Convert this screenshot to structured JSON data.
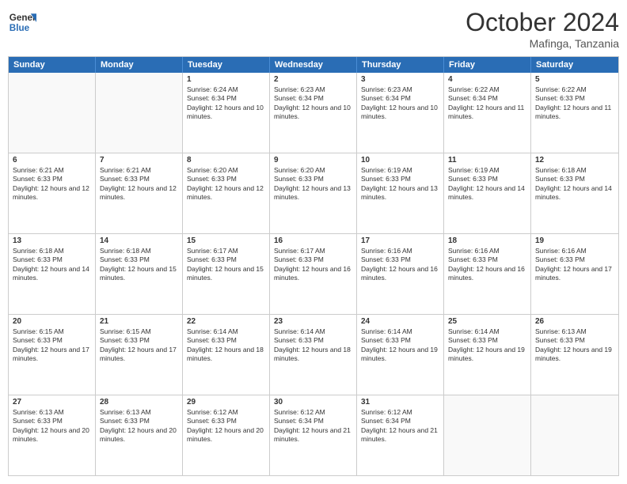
{
  "header": {
    "logo_line1": "General",
    "logo_line2": "Blue",
    "month": "October 2024",
    "location": "Mafinga, Tanzania"
  },
  "days_of_week": [
    "Sunday",
    "Monday",
    "Tuesday",
    "Wednesday",
    "Thursday",
    "Friday",
    "Saturday"
  ],
  "weeks": [
    [
      {
        "day": "",
        "sunrise": "",
        "sunset": "",
        "daylight": ""
      },
      {
        "day": "",
        "sunrise": "",
        "sunset": "",
        "daylight": ""
      },
      {
        "day": "1",
        "sunrise": "Sunrise: 6:24 AM",
        "sunset": "Sunset: 6:34 PM",
        "daylight": "Daylight: 12 hours and 10 minutes."
      },
      {
        "day": "2",
        "sunrise": "Sunrise: 6:23 AM",
        "sunset": "Sunset: 6:34 PM",
        "daylight": "Daylight: 12 hours and 10 minutes."
      },
      {
        "day": "3",
        "sunrise": "Sunrise: 6:23 AM",
        "sunset": "Sunset: 6:34 PM",
        "daylight": "Daylight: 12 hours and 10 minutes."
      },
      {
        "day": "4",
        "sunrise": "Sunrise: 6:22 AM",
        "sunset": "Sunset: 6:34 PM",
        "daylight": "Daylight: 12 hours and 11 minutes."
      },
      {
        "day": "5",
        "sunrise": "Sunrise: 6:22 AM",
        "sunset": "Sunset: 6:33 PM",
        "daylight": "Daylight: 12 hours and 11 minutes."
      }
    ],
    [
      {
        "day": "6",
        "sunrise": "Sunrise: 6:21 AM",
        "sunset": "Sunset: 6:33 PM",
        "daylight": "Daylight: 12 hours and 12 minutes."
      },
      {
        "day": "7",
        "sunrise": "Sunrise: 6:21 AM",
        "sunset": "Sunset: 6:33 PM",
        "daylight": "Daylight: 12 hours and 12 minutes."
      },
      {
        "day": "8",
        "sunrise": "Sunrise: 6:20 AM",
        "sunset": "Sunset: 6:33 PM",
        "daylight": "Daylight: 12 hours and 12 minutes."
      },
      {
        "day": "9",
        "sunrise": "Sunrise: 6:20 AM",
        "sunset": "Sunset: 6:33 PM",
        "daylight": "Daylight: 12 hours and 13 minutes."
      },
      {
        "day": "10",
        "sunrise": "Sunrise: 6:19 AM",
        "sunset": "Sunset: 6:33 PM",
        "daylight": "Daylight: 12 hours and 13 minutes."
      },
      {
        "day": "11",
        "sunrise": "Sunrise: 6:19 AM",
        "sunset": "Sunset: 6:33 PM",
        "daylight": "Daylight: 12 hours and 14 minutes."
      },
      {
        "day": "12",
        "sunrise": "Sunrise: 6:18 AM",
        "sunset": "Sunset: 6:33 PM",
        "daylight": "Daylight: 12 hours and 14 minutes."
      }
    ],
    [
      {
        "day": "13",
        "sunrise": "Sunrise: 6:18 AM",
        "sunset": "Sunset: 6:33 PM",
        "daylight": "Daylight: 12 hours and 14 minutes."
      },
      {
        "day": "14",
        "sunrise": "Sunrise: 6:18 AM",
        "sunset": "Sunset: 6:33 PM",
        "daylight": "Daylight: 12 hours and 15 minutes."
      },
      {
        "day": "15",
        "sunrise": "Sunrise: 6:17 AM",
        "sunset": "Sunset: 6:33 PM",
        "daylight": "Daylight: 12 hours and 15 minutes."
      },
      {
        "day": "16",
        "sunrise": "Sunrise: 6:17 AM",
        "sunset": "Sunset: 6:33 PM",
        "daylight": "Daylight: 12 hours and 16 minutes."
      },
      {
        "day": "17",
        "sunrise": "Sunrise: 6:16 AM",
        "sunset": "Sunset: 6:33 PM",
        "daylight": "Daylight: 12 hours and 16 minutes."
      },
      {
        "day": "18",
        "sunrise": "Sunrise: 6:16 AM",
        "sunset": "Sunset: 6:33 PM",
        "daylight": "Daylight: 12 hours and 16 minutes."
      },
      {
        "day": "19",
        "sunrise": "Sunrise: 6:16 AM",
        "sunset": "Sunset: 6:33 PM",
        "daylight": "Daylight: 12 hours and 17 minutes."
      }
    ],
    [
      {
        "day": "20",
        "sunrise": "Sunrise: 6:15 AM",
        "sunset": "Sunset: 6:33 PM",
        "daylight": "Daylight: 12 hours and 17 minutes."
      },
      {
        "day": "21",
        "sunrise": "Sunrise: 6:15 AM",
        "sunset": "Sunset: 6:33 PM",
        "daylight": "Daylight: 12 hours and 17 minutes."
      },
      {
        "day": "22",
        "sunrise": "Sunrise: 6:14 AM",
        "sunset": "Sunset: 6:33 PM",
        "daylight": "Daylight: 12 hours and 18 minutes."
      },
      {
        "day": "23",
        "sunrise": "Sunrise: 6:14 AM",
        "sunset": "Sunset: 6:33 PM",
        "daylight": "Daylight: 12 hours and 18 minutes."
      },
      {
        "day": "24",
        "sunrise": "Sunrise: 6:14 AM",
        "sunset": "Sunset: 6:33 PM",
        "daylight": "Daylight: 12 hours and 19 minutes."
      },
      {
        "day": "25",
        "sunrise": "Sunrise: 6:14 AM",
        "sunset": "Sunset: 6:33 PM",
        "daylight": "Daylight: 12 hours and 19 minutes."
      },
      {
        "day": "26",
        "sunrise": "Sunrise: 6:13 AM",
        "sunset": "Sunset: 6:33 PM",
        "daylight": "Daylight: 12 hours and 19 minutes."
      }
    ],
    [
      {
        "day": "27",
        "sunrise": "Sunrise: 6:13 AM",
        "sunset": "Sunset: 6:33 PM",
        "daylight": "Daylight: 12 hours and 20 minutes."
      },
      {
        "day": "28",
        "sunrise": "Sunrise: 6:13 AM",
        "sunset": "Sunset: 6:33 PM",
        "daylight": "Daylight: 12 hours and 20 minutes."
      },
      {
        "day": "29",
        "sunrise": "Sunrise: 6:12 AM",
        "sunset": "Sunset: 6:33 PM",
        "daylight": "Daylight: 12 hours and 20 minutes."
      },
      {
        "day": "30",
        "sunrise": "Sunrise: 6:12 AM",
        "sunset": "Sunset: 6:34 PM",
        "daylight": "Daylight: 12 hours and 21 minutes."
      },
      {
        "day": "31",
        "sunrise": "Sunrise: 6:12 AM",
        "sunset": "Sunset: 6:34 PM",
        "daylight": "Daylight: 12 hours and 21 minutes."
      },
      {
        "day": "",
        "sunrise": "",
        "sunset": "",
        "daylight": ""
      },
      {
        "day": "",
        "sunrise": "",
        "sunset": "",
        "daylight": ""
      }
    ]
  ]
}
